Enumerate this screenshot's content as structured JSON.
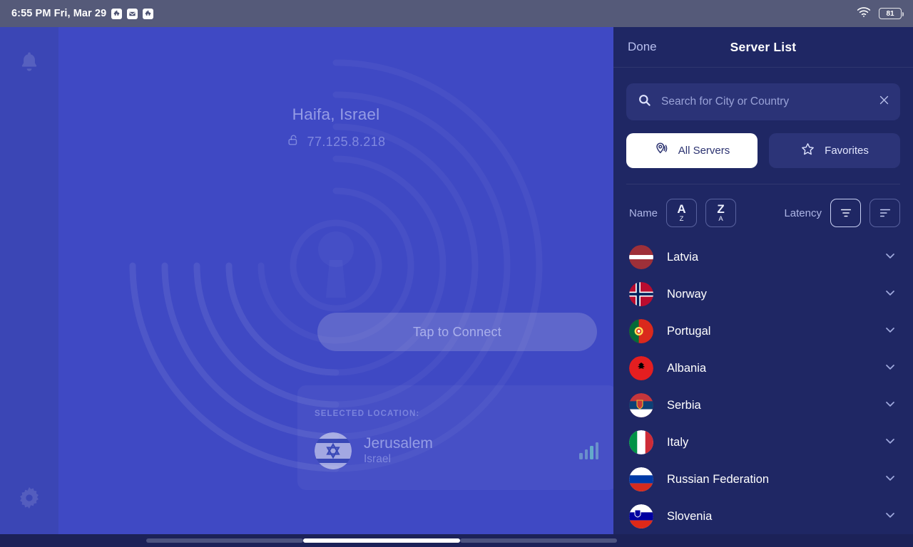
{
  "status_bar": {
    "time": "6:55 PM Fri, Mar 29",
    "app_icons": [
      "puzzle-icon",
      "mail-icon",
      "puzzle-icon"
    ],
    "wifi_icon": "wifi-icon",
    "battery_level": "81"
  },
  "rail": {
    "notifications_icon": "bell-icon",
    "settings_icon": "gear-icon"
  },
  "vpn": {
    "location": "Haifa, Israel",
    "lock_icon": "unlock-icon",
    "ip_address": "77.125.8.218",
    "connect_label": "Tap to Connect",
    "selected_location_label": "SELECTED LOCATION:",
    "selected_city": "Jerusalem",
    "selected_country": "Israel",
    "signal_icon": "signal-bars-icon",
    "background_icon": "keyhole-icon",
    "panel_color": "#3f49c4",
    "rail_color": "#3b46b5"
  },
  "server_panel": {
    "done_label": "Done",
    "title": "Server List",
    "panel_color": "#1f2764",
    "search": {
      "placeholder": "Search for City or Country",
      "value": "",
      "search_icon": "search-icon",
      "clear_icon": "close-icon"
    },
    "segments": [
      {
        "label": "All Servers",
        "icon": "map-pin-icon",
        "active": true
      },
      {
        "label": "Favorites",
        "icon": "star-icon",
        "active": false
      }
    ],
    "sort": {
      "name_label": "Name",
      "latency_label": "Latency",
      "name_asc": {
        "top": "A",
        "bottom": "Z",
        "icon": "sort-a-z-icon"
      },
      "name_desc": {
        "top": "Z",
        "bottom": "A",
        "icon": "sort-z-a-icon"
      },
      "latency_asc_icon": "sort-ascending-icon",
      "latency_desc_icon": "sort-descending-icon",
      "selected": "latency_asc"
    },
    "countries": [
      {
        "name": "Latvia",
        "flag": "latvia-flag-icon"
      },
      {
        "name": "Norway",
        "flag": "norway-flag-icon"
      },
      {
        "name": "Portugal",
        "flag": "portugal-flag-icon"
      },
      {
        "name": "Albania",
        "flag": "albania-flag-icon"
      },
      {
        "name": "Serbia",
        "flag": "serbia-flag-icon"
      },
      {
        "name": "Italy",
        "flag": "italy-flag-icon"
      },
      {
        "name": "Russian Federation",
        "flag": "russia-flag-icon"
      },
      {
        "name": "Slovenia",
        "flag": "slovenia-flag-icon"
      }
    ],
    "expand_icon": "chevron-down-icon"
  }
}
